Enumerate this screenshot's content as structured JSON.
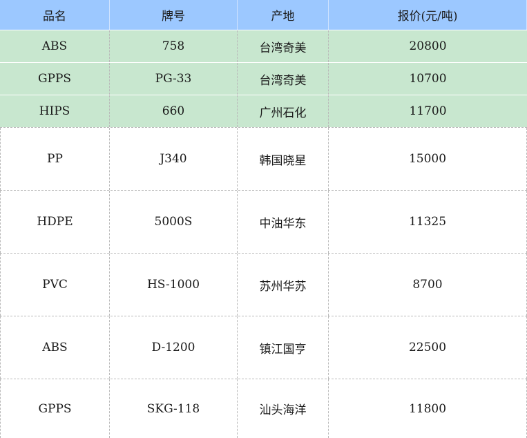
{
  "table": {
    "headers": [
      "品名",
      "牌号",
      "产地",
      "报价(元/吨)"
    ],
    "rows": [
      [
        "ABS",
        "758",
        "台湾奇美",
        "20800"
      ],
      [
        "GPPS",
        "PG-33",
        "台湾奇美",
        "10700"
      ],
      [
        "HIPS",
        "660",
        "广州石化",
        "11700"
      ],
      [
        "PP",
        "J340",
        "韩国晓星",
        "15000"
      ],
      [
        "HDPE",
        "5000S",
        "中油华东",
        "11325"
      ],
      [
        "PVC",
        "HS-1000",
        "苏州华苏",
        "8700"
      ],
      [
        "ABS",
        "D-1200",
        "镇江国亨",
        "22500"
      ],
      [
        "GPPS",
        "SKG-118",
        "汕头海洋",
        "11800"
      ]
    ]
  },
  "colors": {
    "header_bg": "#9cc8ff",
    "highlight_row_bg": "#c8e7cf",
    "plain_row_bg": "#ffffff"
  }
}
